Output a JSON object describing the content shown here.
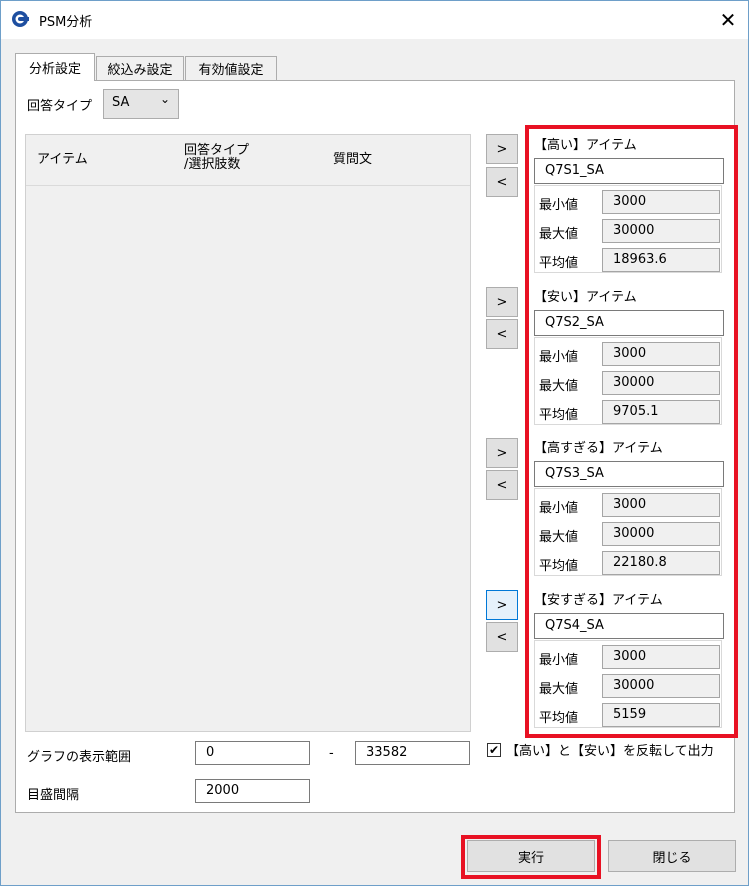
{
  "window": {
    "title": "PSM分析",
    "close_glyph": "✕"
  },
  "tabs": [
    {
      "label": "分析設定",
      "active": true
    },
    {
      "label": "絞込み設定",
      "active": false
    },
    {
      "label": "有効値設定",
      "active": false
    }
  ],
  "answer_type": {
    "label": "回答タイプ",
    "value": "SA"
  },
  "list": {
    "columns": [
      "アイテム",
      "回答タイプ\n/選択肢数",
      "質問文"
    ],
    "col1_line1": "回答タイプ",
    "col1_line2": "/選択肢数"
  },
  "move_buttons": {
    "add": ">",
    "remove": "<"
  },
  "groups": [
    {
      "title": "【高い】アイテム",
      "item": "Q7S1_SA",
      "min_label": "最小値",
      "min": "3000",
      "max_label": "最大値",
      "max": "30000",
      "avg_label": "平均値",
      "avg": "18963.6"
    },
    {
      "title": "【安い】アイテム",
      "item": "Q7S2_SA",
      "min_label": "最小値",
      "min": "3000",
      "max_label": "最大値",
      "max": "30000",
      "avg_label": "平均値",
      "avg": "9705.1"
    },
    {
      "title": "【高すぎる】アイテム",
      "item": "Q7S3_SA",
      "min_label": "最小値",
      "min": "3000",
      "max_label": "最大値",
      "max": "30000",
      "avg_label": "平均値",
      "avg": "22180.8"
    },
    {
      "title": "【安すぎる】アイテム",
      "item": "Q7S4_SA",
      "min_label": "最小値",
      "min": "3000",
      "max_label": "最大値",
      "max": "30000",
      "avg_label": "平均値",
      "avg": "5159"
    }
  ],
  "graph_range": {
    "label": "グラフの表示範囲",
    "from": "0",
    "separator": "-",
    "to": "33582"
  },
  "tick_interval": {
    "label": "目盛間隔",
    "value": "2000"
  },
  "invert_option": {
    "label": "【高い】と【安い】を反転して出力",
    "checked": true,
    "check_glyph": "✔"
  },
  "footer": {
    "run_label": "実行",
    "close_label": "閉じる"
  },
  "colors": {
    "highlight": "#e81123",
    "accent": "#0078d7",
    "icon_blue": "#1e4fa0"
  }
}
